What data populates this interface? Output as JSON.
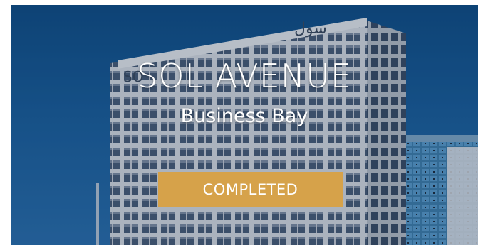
{
  "hero": {
    "title": "SOL AVENUE",
    "subtitle": "Business Bay",
    "status_button": "COMPLETED"
  },
  "colors": {
    "sky": "#1a5e9c",
    "button": "#d6a24a",
    "text": "#ffffff"
  }
}
